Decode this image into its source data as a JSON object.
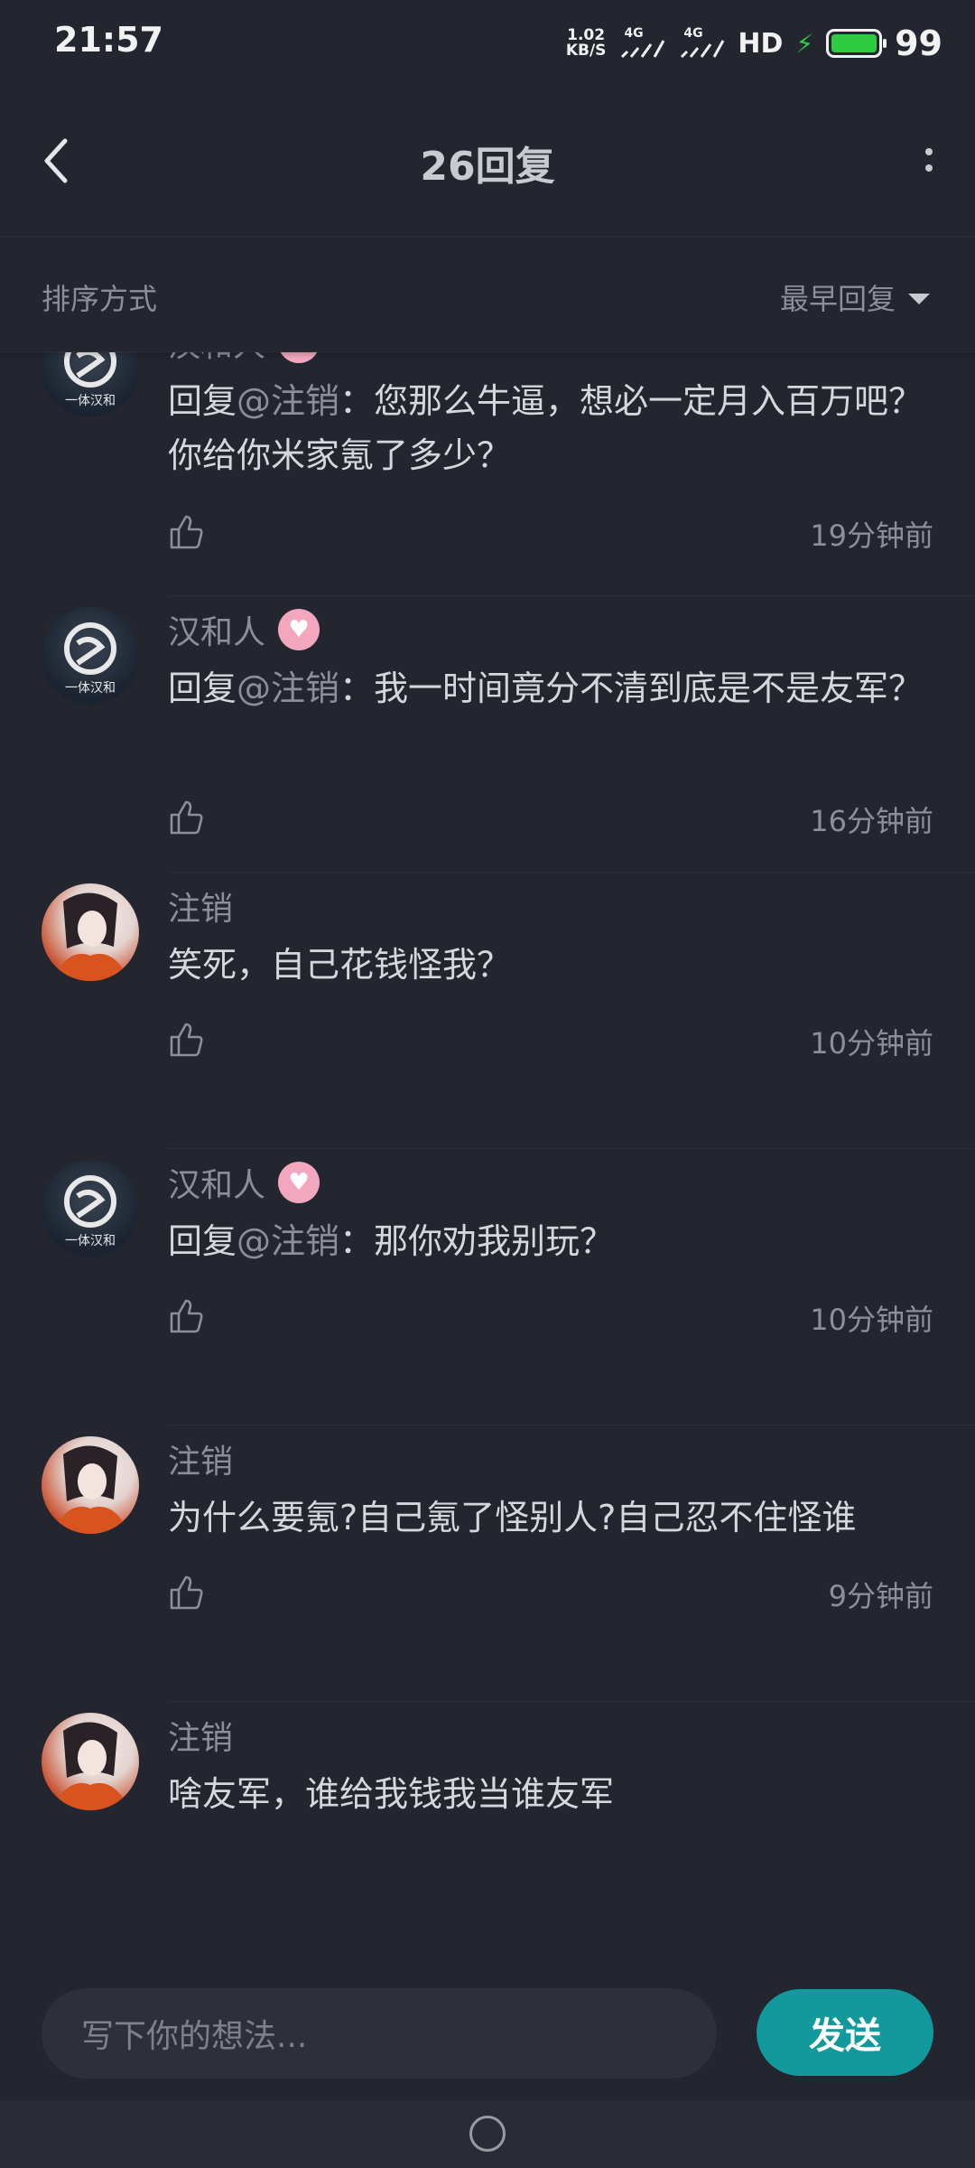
{
  "status_bar": {
    "time": "21:57",
    "net_speed_value": "1.02",
    "net_speed_unit": "KB/S",
    "signal_1": "4G",
    "signal_2": "4G",
    "hd": "HD",
    "battery": "99"
  },
  "header": {
    "title": "26回复"
  },
  "sort": {
    "label": "排序方式",
    "selected": "最早回复"
  },
  "replies": [
    {
      "name": "汉和人",
      "prefix": "回复",
      "mention": "@注销",
      "content": "：您那么牛逼，想必一定月入百万吧？你给你米家氪了多少？",
      "time": "19分钟前"
    },
    {
      "name": "汉和人",
      "prefix": "回复",
      "mention": "@注销",
      "content": "：我一时间竟分不清到底是不是友军？",
      "time": "16分钟前"
    },
    {
      "name": "注销",
      "content": "笑死，自己花钱怪我？",
      "time": "10分钟前"
    },
    {
      "name": "汉和人",
      "prefix": "回复",
      "mention": "@注销",
      "content": "：那你劝我别玩？",
      "time": "10分钟前"
    },
    {
      "name": "注销",
      "content": "为什么要氪?自己氪了怪别人?自己忍不住怪谁",
      "time": "9分钟前"
    },
    {
      "name": "注销",
      "content": "啥友军，谁给我钱我当谁友军"
    }
  ],
  "composer": {
    "placeholder": "写下你的想法...",
    "send_label": "发送"
  },
  "colors": {
    "background": "#23252f",
    "accent": "#12999d",
    "badge": "#f2a7bf"
  }
}
